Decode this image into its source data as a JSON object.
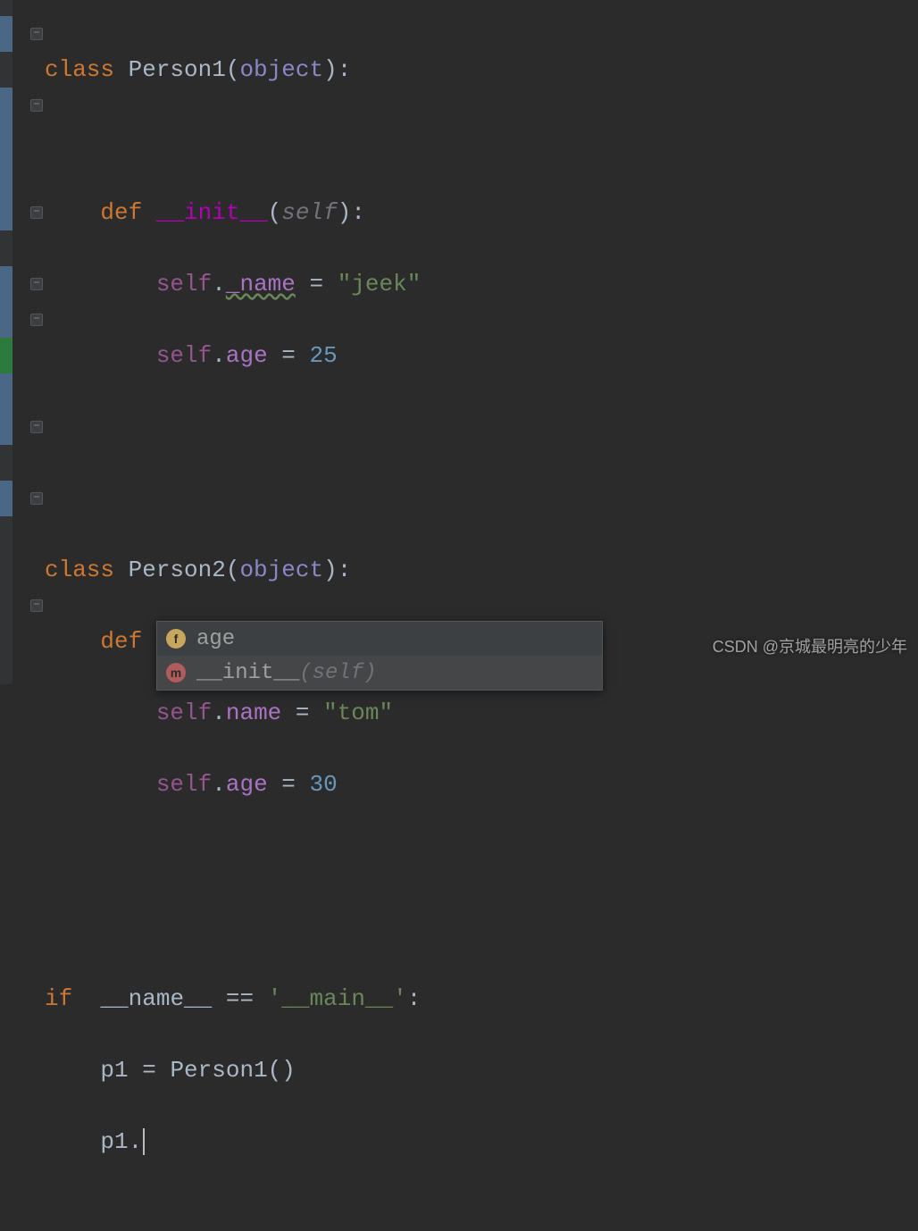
{
  "code": {
    "kw_class": "class",
    "cls1": "Person1",
    "cls2": "Person2",
    "builtin_object": "object",
    "kw_def": "def",
    "magic_init": "__init__",
    "param_self": "self",
    "self": "self",
    "attr_name_u": "_name",
    "attr_name": "name",
    "attr_age": "age",
    "str_jeek": "\"jeek\"",
    "str_tom": "\"tom\"",
    "num_25": "25",
    "num_30": "30",
    "kw_if": "if",
    "dunder_name": "__name__",
    "op_eq": "==",
    "str_main": "'__main__'",
    "var_p1": "p1",
    "call_person1": "Person1()",
    "dot": ".",
    "colon": ":",
    "eq": " = ",
    "lp": "(",
    "rp": ")"
  },
  "autocomplete": {
    "items": [
      {
        "icon": "f",
        "kind": "field",
        "label": "age",
        "params": ""
      },
      {
        "icon": "m",
        "kind": "method",
        "label": "__init__",
        "params": "(self)"
      }
    ]
  },
  "watermark": "CSDN @京城最明亮的少年"
}
